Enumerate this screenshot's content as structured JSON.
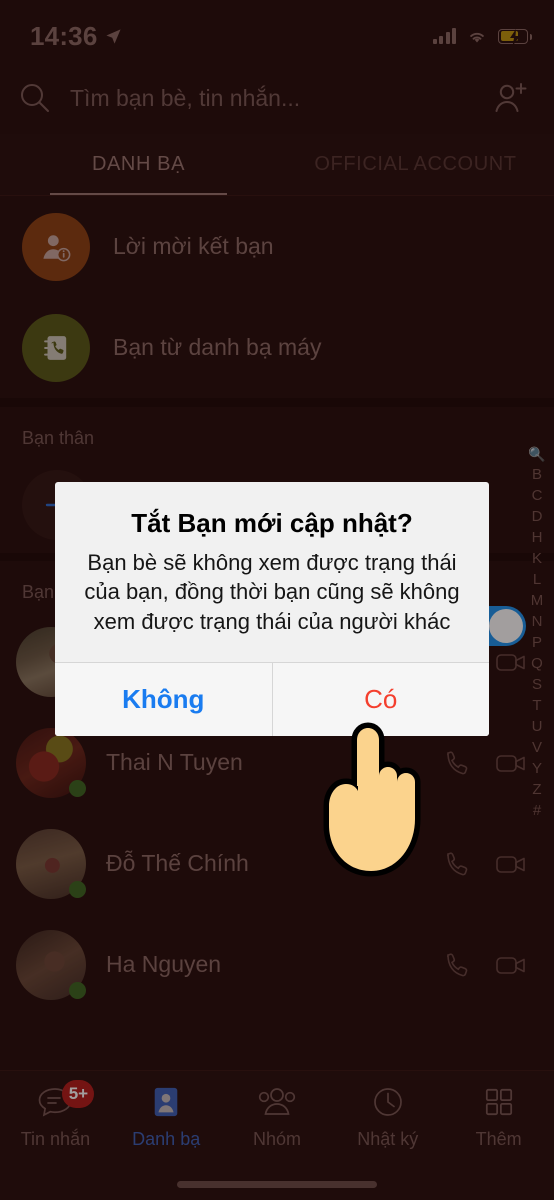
{
  "status_bar": {
    "time": "14:36",
    "location_icon": "location-arrow-icon",
    "signal_icon": "cellular-signal-icon",
    "wifi_icon": "wifi-icon",
    "battery_icon": "battery-charging-icon"
  },
  "search": {
    "placeholder": "Tìm bạn bè, tin nhắn...",
    "search_icon": "search-icon",
    "add_friend_icon": "add-friend-icon"
  },
  "tabs": [
    {
      "label": "DANH BẠ",
      "active": true
    },
    {
      "label": "OFFICIAL ACCOUNT",
      "active": false
    }
  ],
  "shortcuts": [
    {
      "label": "Lời mời kết bạn",
      "icon": "friend-request-icon",
      "color": "#8e4417"
    },
    {
      "label": "Bạn từ danh bạ máy",
      "icon": "phonebook-icon",
      "color": "#5b5c1c"
    }
  ],
  "sections": {
    "favorites_title": "Bạn thân",
    "favorites_add_icon": "plus-icon",
    "friends_title": "Bạn"
  },
  "contacts": [
    {
      "name": "",
      "online": true,
      "call_icon": "phone-icon",
      "video_icon": "video-camera-icon"
    },
    {
      "name": "Thai N Tuyen",
      "online": true,
      "call_icon": "phone-icon",
      "video_icon": "video-camera-icon"
    },
    {
      "name": "Đỗ Thế Chính",
      "online": true,
      "call_icon": "phone-icon",
      "video_icon": "video-camera-icon"
    },
    {
      "name": "Ha Nguyen",
      "online": true,
      "call_icon": "phone-icon",
      "video_icon": "video-camera-icon"
    }
  ],
  "alphabet_index": [
    "B",
    "C",
    "D",
    "H",
    "K",
    "L",
    "M",
    "N",
    "P",
    "Q",
    "S",
    "T",
    "U",
    "V",
    "Y",
    "Z",
    "#"
  ],
  "toggle": {
    "state": "on",
    "color": "#2196f3"
  },
  "dialog": {
    "title": "Tắt Bạn mới cập nhật?",
    "message": "Bạn bè sẽ không xem được trạng thái của bạn, đồng thời bạn cũng sẽ không xem được trạng thái của người khác",
    "cancel_label": "Không",
    "confirm_label": "Có",
    "cancel_color": "#1a7cf0",
    "confirm_color": "#f43f2e"
  },
  "bottom_nav": [
    {
      "label": "Tin nhắn",
      "icon": "chat-bubble-icon",
      "badge": "5+",
      "active": false
    },
    {
      "label": "Danh bạ",
      "icon": "contacts-card-icon",
      "badge": "",
      "active": true
    },
    {
      "label": "Nhóm",
      "icon": "group-people-icon",
      "badge": "",
      "active": false
    },
    {
      "label": "Nhật ký",
      "icon": "clock-icon",
      "badge": "",
      "active": false
    },
    {
      "label": "Thêm",
      "icon": "grid-more-icon",
      "badge": "",
      "active": false
    }
  ],
  "cursor": {
    "icon": "pointing-hand-cursor"
  }
}
